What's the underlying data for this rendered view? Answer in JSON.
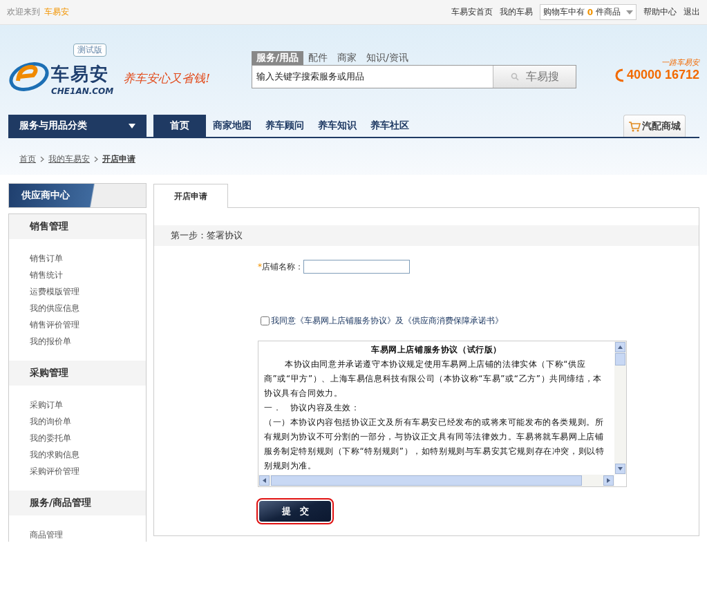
{
  "top_bar": {
    "welcome": "欢迎来到",
    "brand": "车易安",
    "links": [
      "车易安首页",
      "我的车易"
    ],
    "cart": {
      "prefix": "购物车中有",
      "count": "0",
      "suffix": "件商品"
    },
    "links_end": [
      "帮助中心",
      "退出"
    ]
  },
  "header": {
    "logo_text": "车易安",
    "logo_domain": "CHE1AN.COM",
    "badge": "测试版",
    "slogan": "养车安心又省钱!",
    "search_tabs": [
      {
        "label": "服务/用品",
        "selected": true
      },
      {
        "label": "配件",
        "selected": false
      },
      {
        "label": "商家",
        "selected": false
      },
      {
        "label": "知识/资讯",
        "selected": false
      }
    ],
    "search_value": "输入关键字搜索服务或用品",
    "search_button": "车易搜",
    "phone_caption": "一路车易安",
    "phone": "40000 16712"
  },
  "nav": {
    "category": "服务与用品分类",
    "items": [
      {
        "label": "首页",
        "selected": true
      },
      {
        "label": "商家地图",
        "selected": false
      },
      {
        "label": "养车顾问",
        "selected": false
      },
      {
        "label": "养车知识",
        "selected": false
      },
      {
        "label": "养车社区",
        "selected": false
      }
    ],
    "mall": "汽配商城"
  },
  "breadcrumb": [
    {
      "label": "首页",
      "current": false
    },
    {
      "label": "我的车易安",
      "current": false
    },
    {
      "label": "开店申请",
      "current": true
    }
  ],
  "sidebar": {
    "title": "供应商中心",
    "groups": [
      {
        "title": "销售管理",
        "items": [
          "销售订单",
          "销售统计",
          "运费模版管理",
          "我的供应信息",
          "销售评价管理",
          "我的报价单"
        ]
      },
      {
        "title": "采购管理",
        "items": [
          "采购订单",
          "我的询价单",
          "我的委托单",
          "我的求购信息",
          "采购评价管理"
        ]
      },
      {
        "title": "服务/商品管理",
        "items": [
          "商品管理"
        ]
      }
    ]
  },
  "content": {
    "tab": "开店申请",
    "step": "第一步：签署协议",
    "store_field": {
      "required_mark": "*",
      "label": "店铺名称："
    },
    "agree": {
      "checked": false,
      "text": "我同意《车易网上店铺服务协议》及《供应商消费保障承诺书》"
    },
    "agreement": {
      "title": "车易网上店铺服务协议（试行版）",
      "paragraphs": [
        "本协议由同意并承诺遵守本协议规定使用车易网上店铺的法律实体（下称“供应商”或“甲方”）、上海车易信息科技有限公司（本协议称“车易”或“乙方”）共同缔结，本协议具有合同效力。",
        "一．　协议内容及生效：",
        "（一）本协议内容包括协议正文及所有车易安已经发布的或将来可能发布的各类规则。所有规则为协议不可分割的一部分，与协议正文具有同等法律效力。车易将就车易网上店铺服务制定特别规则（下称“特别规则”），如特别规则与车易安其它规则存在冲突，则以特别规则为准。"
      ]
    },
    "submit": "提　交",
    "submit_focused": true
  }
}
